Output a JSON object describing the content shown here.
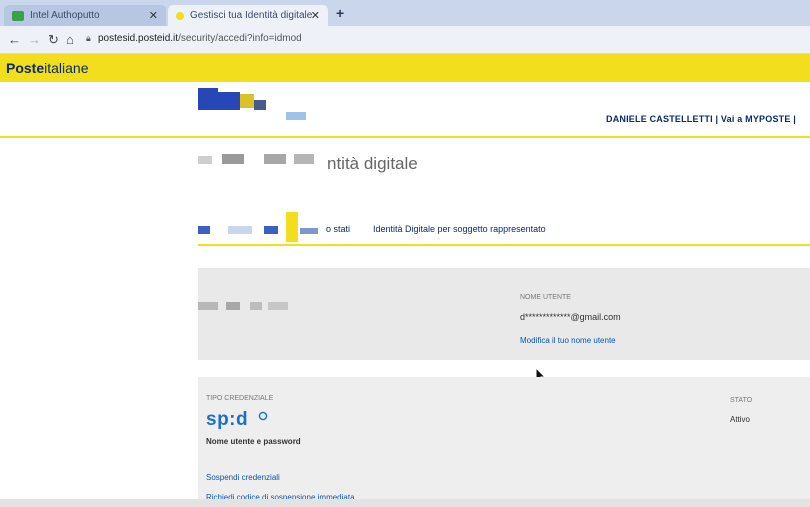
{
  "browser": {
    "tabs": [
      {
        "label": "Intel Authoputto",
        "active": false
      },
      {
        "label": "Gestisci tua Identità digitale",
        "active": true
      }
    ],
    "new_tab": "+",
    "url_host": "postesid.posteid.it",
    "url_path": "/security/accedi?info=idmod"
  },
  "site": {
    "logo_bold": "Poste",
    "logo_regular": "italiane",
    "user_links": "DANIELE CASTELLETTI  |  Vai a MYPOSTE  |"
  },
  "page": {
    "title": "ntità digitale",
    "subnav": {
      "link_1": "o stati",
      "link_2": "Identità Digitale per soggetto rappresentato"
    }
  },
  "user_panel": {
    "username_label": "NOME UTENTE",
    "username_value": "d*************@gmail.com",
    "edit_link": "Modifica il tuo nome utente"
  },
  "credentials_panel": {
    "type_label": "TIPO CREDENZIALE",
    "spid_logo": "sp:d",
    "credential_type": "Nome utente e password",
    "state_label": "STATO",
    "state_value": "Attivo",
    "suspend_link": "Sospendi credenziali",
    "request_link": "Richiedi codice di sospensione immediata"
  },
  "colors": {
    "poste_yellow": "#f2de1c",
    "poste_blue": "#0b2a6b",
    "link_blue": "#0b55b0"
  }
}
